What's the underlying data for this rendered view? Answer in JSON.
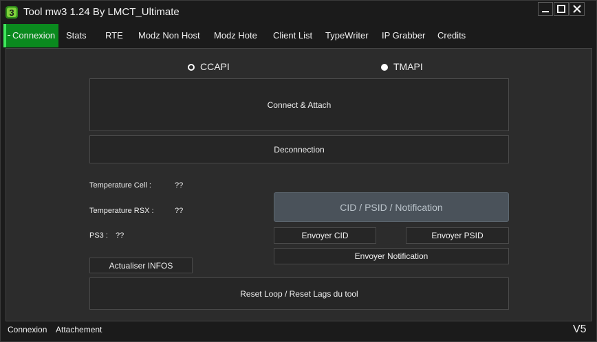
{
  "window": {
    "title": "Tool mw3 1.24 By LMCT_Ultimate",
    "icons": {
      "logo": "game-logo-icon",
      "minimize": "minimize-icon",
      "maximize": "maximize-icon",
      "close": "close-icon"
    }
  },
  "menu": {
    "tabs": [
      {
        "label": "Connexion",
        "active": true
      },
      {
        "label": "Stats"
      },
      {
        "label": "RTE"
      },
      {
        "label": "Modz Non Host"
      },
      {
        "label": "Modz Hote"
      },
      {
        "label": "Client List"
      },
      {
        "label": "TypeWriter"
      },
      {
        "label": "IP Grabber"
      },
      {
        "label": "Credits"
      }
    ]
  },
  "connection": {
    "api_options": [
      {
        "label": "CCAPI",
        "selected": false
      },
      {
        "label": "TMAPI",
        "selected": true
      }
    ],
    "connect_attach": "Connect & Attach",
    "disconnect": "Deconnection"
  },
  "info": {
    "temp_cell_label": "Temperature Cell :",
    "temp_cell_value": "??",
    "temp_rsx_label": "Temperature RSX :",
    "temp_rsx_value": "??",
    "ps3_label": "PS3 :",
    "ps3_value": "??",
    "refresh": "Actualiser INFOS"
  },
  "notify": {
    "placeholder": "CID / PSID / Notification",
    "send_cid": "Envoyer CID",
    "send_psid": "Envoyer PSID",
    "send_notification": "Envoyer Notification"
  },
  "reset": "Reset Loop / Reset Lags du tool",
  "statusbar": {
    "connexion": "Connexion",
    "attachement": "Attachement",
    "version": "V5"
  },
  "colors": {
    "active_tab": "#0a8a1e",
    "panel": "#2c2c2c",
    "background": "#1b1b1b",
    "input": "#4a525a"
  }
}
